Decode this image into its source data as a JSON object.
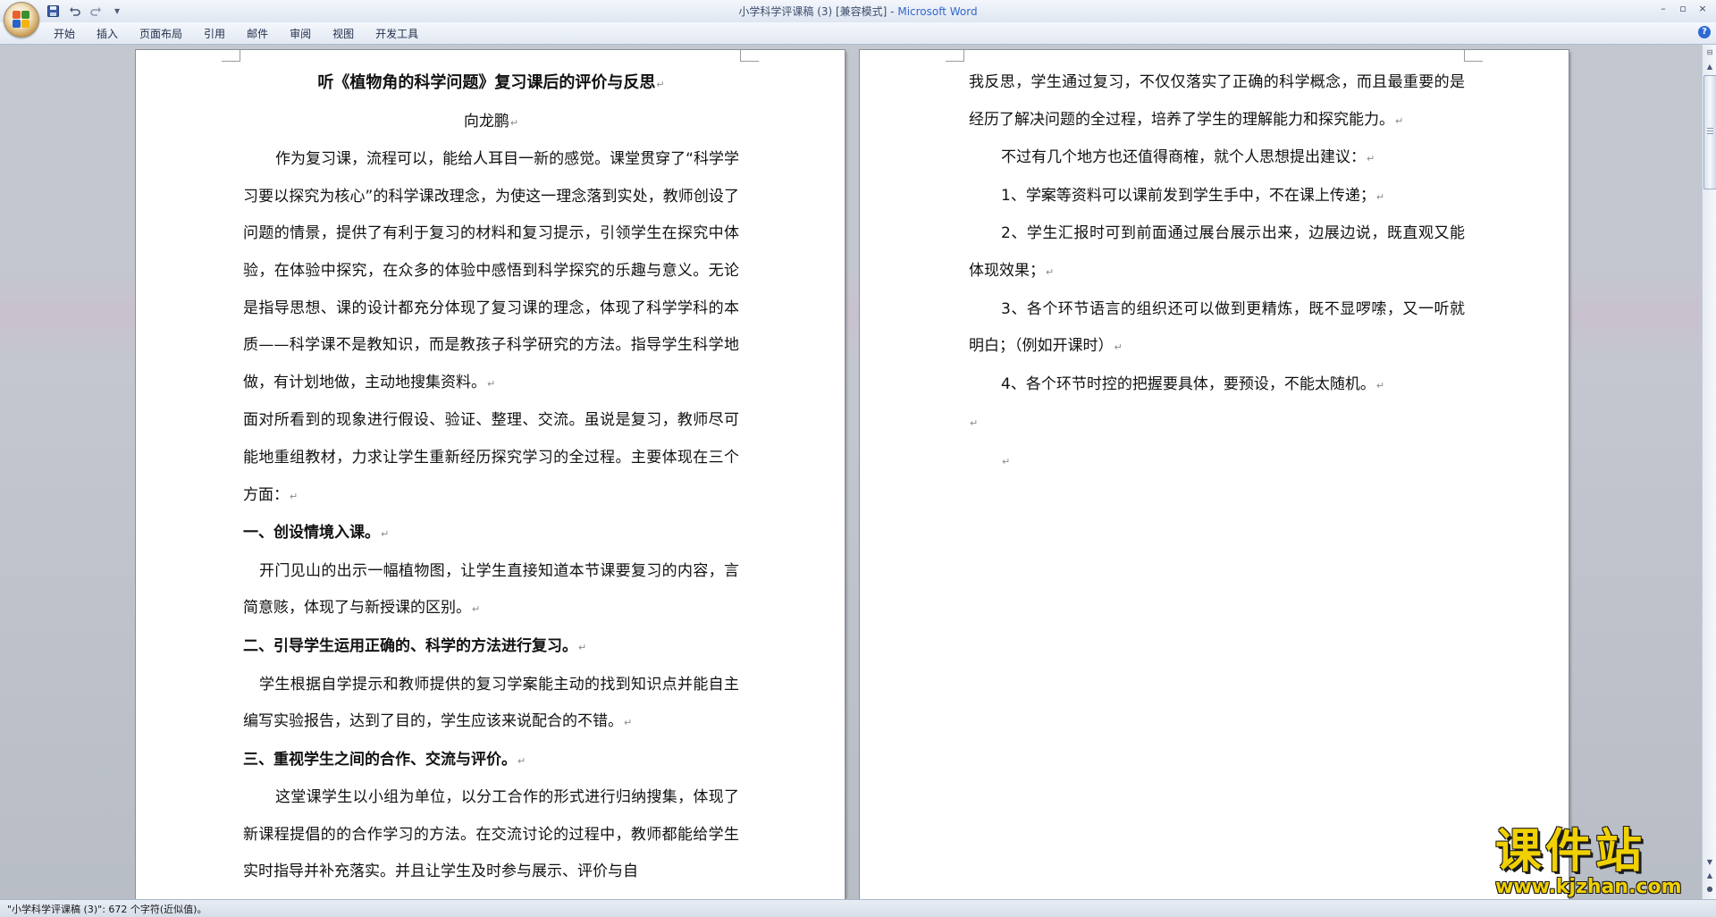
{
  "window": {
    "title": "小学科学评课稿 (3) [兼容模式] -",
    "app_name": "Microsoft Word",
    "controls": {
      "minimize": "–",
      "restore": "▫",
      "close": "×"
    }
  },
  "quick_access": {
    "save_icon": "save-icon",
    "undo_icon": "undo-icon",
    "redo_icon": "redo-icon",
    "customize": "▾"
  },
  "ribbon": {
    "tabs": [
      "开始",
      "插入",
      "页面布局",
      "引用",
      "邮件",
      "审阅",
      "视图",
      "开发工具"
    ],
    "help": "?"
  },
  "page1": {
    "title": "听《植物角的科学问题》复习课后的评价与反思",
    "author": "向龙鹏",
    "paragraphs": {
      "p1": "作为复习课，流程可以，能给人耳目一新的感觉。课堂贯穿了“科学学习要以探究为核心”的科学课改理念，为使这一理念落到实处，教师创设了问题的情景，提供了有利于复习的材料和复习提示，引领学生在探究中体验，在体验中探究，在众多的体验中感悟到科学探究的乐趣与意义。无论是指导思想、课的设计都充分体现了复习课的理念，体现了科学学科的本质——科学课不是教知识，而是教孩子科学研究的方法。指导学生科学地做，有计划地做，主动地搜集资料。",
      "p2": "面对所看到的现象进行假设、验证、整理、交流。虽说是复习，教师尽可能地重组教材，力求让学生重新经历探究学习的全过程。主要体现在三个方面：",
      "h1": "一、创设情境入课。",
      "p3": "开门见山的出示一幅植物图，让学生直接知道本节课要复习的内容，言简意赅，体现了与新授课的区别。",
      "h2": "二、引导学生运用正确的、科学的方法进行复习。",
      "p4": "学生根据自学提示和教师提供的复习学案能主动的找到知识点并能自主编写实验报告，达到了目的，学生应该来说配合的不错。",
      "h3": "三、重视学生之间的合作、交流与评价。",
      "p5": "这堂课学生以小组为单位，以分工合作的形式进行归纳搜集，体现了新课程提倡的的合作学习的方法。在交流讨论的过程中，教师都能给学生实时指导并补充落实。并且让学生及时参与展示、评价与自"
    }
  },
  "page2": {
    "paragraphs": {
      "p1": "我反思，学生通过复习，不仅仅落实了正确的科学概念，而且最重要的是经历了解决问题的全过程，培养了学生的理解能力和探究能力。",
      "p2": "不过有几个地方也还值得商榷，就个人思想提出建议：",
      "p3": "1、学案等资料可以课前发到学生手中，不在课上传递；",
      "p4": "2、学生汇报时可到前面通过展台展示出来，边展边说，既直观又能体现效果；",
      "p5": "3、各个环节语言的组织还可以做到更精炼，既不显啰嗦，又一听就明白；（例如开课时）",
      "p6": "4、各个环节时控的把握要具体，要预设，不能太随机。"
    }
  },
  "paragraph_mark": "↵",
  "status_bar": {
    "text": "\"小学科学评课稿 (3)\": 672 个字符(近似值)。"
  },
  "scrollbar": {
    "up": "▲",
    "down": "▼",
    "prev_page": "▲",
    "browse": "●",
    "next_page": "▼",
    "ruler": "⊟"
  },
  "watermark": {
    "name": "课件站",
    "url": "www.kjzhan.com"
  },
  "colors": {
    "app_name": "#3366cc",
    "watermark": "#f0d000",
    "page": "#ffffff"
  }
}
